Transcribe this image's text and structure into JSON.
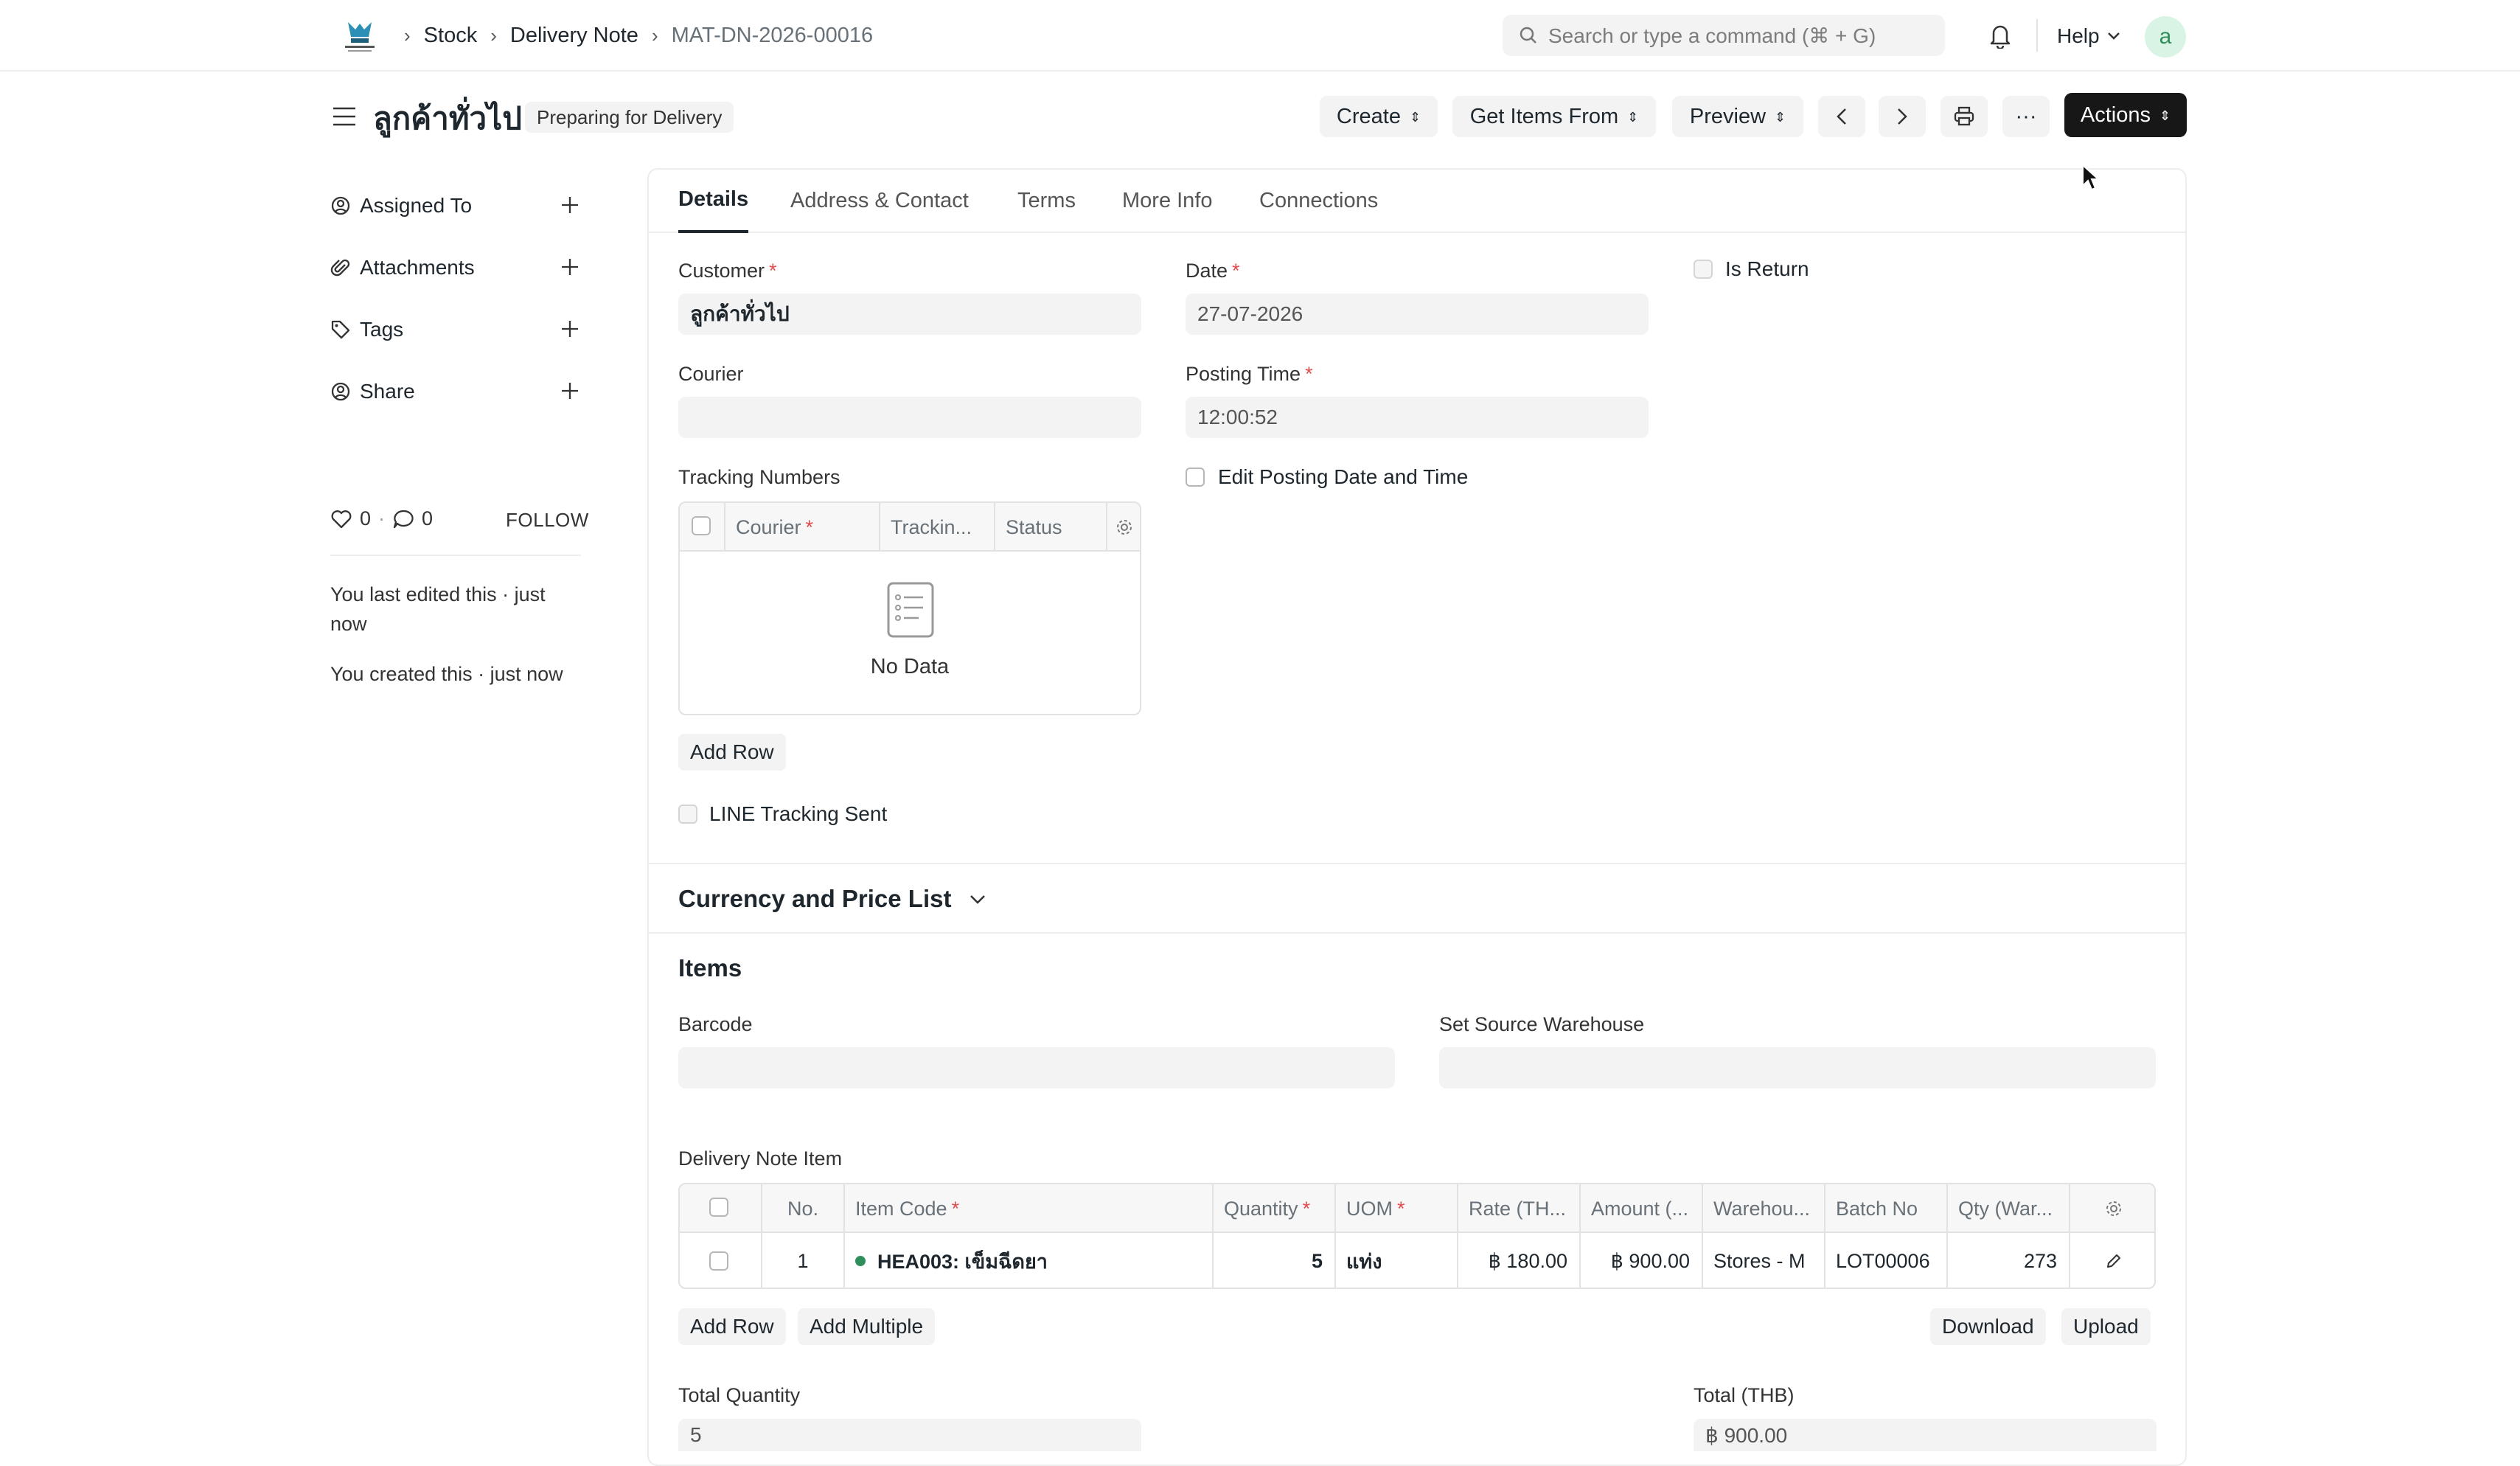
{
  "navbar": {
    "breadcrumbs": [
      "Stock",
      "Delivery Note",
      "MAT-DN-2026-00016"
    ],
    "search_placeholder": "Search or type a command (⌘ + G)",
    "help_label": "Help",
    "avatar_letter": "a"
  },
  "page": {
    "title": "ลูกค้าทั่วไป",
    "status": "Preparing for Delivery"
  },
  "toolbar": {
    "create": "Create",
    "get_items_from": "Get Items From",
    "preview": "Preview",
    "more": "···",
    "actions": "Actions"
  },
  "sidebar": {
    "items": [
      {
        "label": "Assigned To",
        "icon": "assign-icon"
      },
      {
        "label": "Attachments",
        "icon": "paperclip-icon"
      },
      {
        "label": "Tags",
        "icon": "tag-icon"
      },
      {
        "label": "Share",
        "icon": "share-icon"
      }
    ],
    "likes": "0",
    "comments": "0",
    "follow": "FOLLOW",
    "last_edited": "You last edited this · just now",
    "created": "You created this · just now"
  },
  "tabs": [
    "Details",
    "Address & Contact",
    "Terms",
    "More Info",
    "Connections"
  ],
  "details": {
    "customer_label": "Customer",
    "customer_value": "ลูกค้าทั่วไป",
    "date_label": "Date",
    "date_value": "27-07-2026",
    "is_return_label": "Is Return",
    "courier_label": "Courier",
    "courier_value": "",
    "posting_time_label": "Posting Time",
    "posting_time_value": "12:00:52",
    "tracking_label": "Tracking Numbers",
    "tracking_columns": [
      "Courier",
      "Trackin...",
      "Status"
    ],
    "no_data": "No Data",
    "edit_posting_label": "Edit Posting Date and Time",
    "add_row": "Add Row",
    "line_tracking_label": "LINE Tracking Sent"
  },
  "currency_section": {
    "title": "Currency and Price List"
  },
  "items_section": {
    "title": "Items",
    "barcode_label": "Barcode",
    "source_warehouse_label": "Set Source Warehouse",
    "table_label": "Delivery Note Item",
    "columns": [
      "No.",
      "Item Code",
      "Quantity",
      "UOM",
      "Rate (TH...",
      "Amount (...",
      "Warehou...",
      "Batch No",
      "Qty (War..."
    ],
    "rows": [
      {
        "no": "1",
        "item_code": "HEA003: เข็มฉีดยา",
        "quantity": "5",
        "uom": "แท่ง",
        "rate": "฿ 180.00",
        "amount": "฿ 900.00",
        "warehouse": "Stores - M",
        "batch": "LOT00006",
        "qty_wh": "273"
      }
    ],
    "add_row": "Add Row",
    "add_multiple": "Add Multiple",
    "download": "Download",
    "upload": "Upload",
    "total_qty_label": "Total Quantity",
    "total_qty_value": "5",
    "total_label": "Total (THB)",
    "total_value": "฿ 900.00"
  }
}
